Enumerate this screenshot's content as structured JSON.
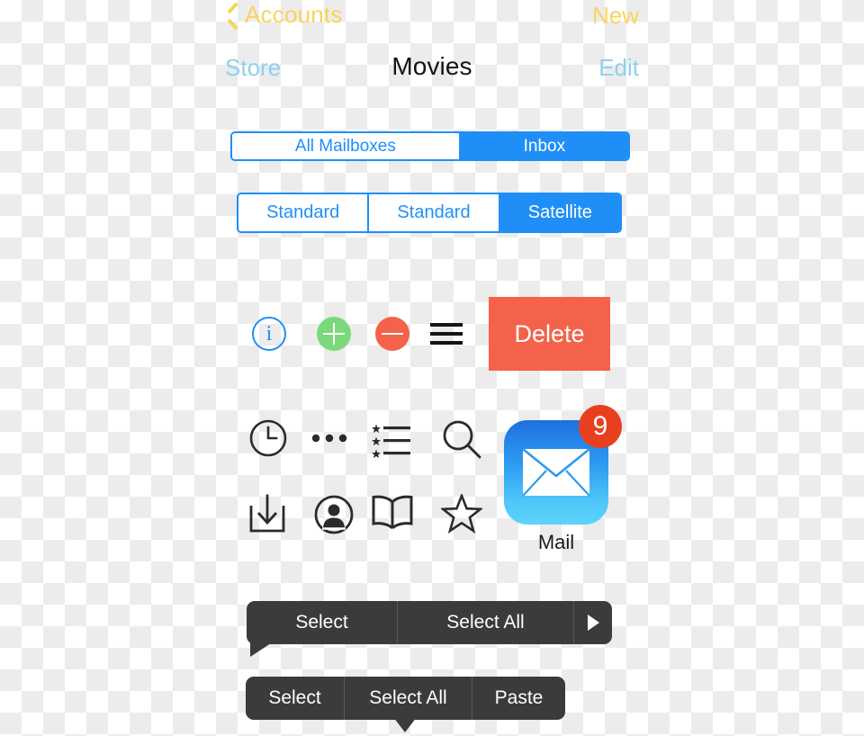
{
  "nav": {
    "row1": {
      "back_label": "Accounts",
      "back_icon": "chevron-left-icon",
      "right_label": "New"
    },
    "row2": {
      "left_label": "Store",
      "title": "Movies",
      "right_label": "Edit"
    }
  },
  "segmented_controls": [
    {
      "name": "mailbox-scope",
      "options": [
        {
          "label": "All Mailboxes",
          "selected": false
        },
        {
          "label": "Inbox",
          "selected": true
        }
      ]
    },
    {
      "name": "map-type",
      "options": [
        {
          "label": "Standard",
          "selected": false
        },
        {
          "label": "Standard",
          "selected": false
        },
        {
          "label": "Satellite",
          "selected": true
        }
      ]
    }
  ],
  "controls_row": {
    "info_glyph": "i",
    "info_icon": "info-circle-icon",
    "add_icon": "plus-circle-icon",
    "remove_icon": "minus-circle-icon",
    "reorder_icon": "hamburger-icon",
    "delete_label": "Delete"
  },
  "glyph_icons": [
    {
      "name": "clock-icon",
      "label": "clock"
    },
    {
      "name": "ellipsis-icon",
      "label": "more"
    },
    {
      "name": "starred-list-icon",
      "label": "starred list"
    },
    {
      "name": "search-icon",
      "label": "search"
    },
    {
      "name": "download-icon",
      "label": "download"
    },
    {
      "name": "contact-icon",
      "label": "contact"
    },
    {
      "name": "book-icon",
      "label": "book"
    },
    {
      "name": "star-icon",
      "label": "star"
    }
  ],
  "app_icon": {
    "name": "mail-app-icon",
    "label": "Mail",
    "badge_count": "9",
    "glyph": "envelope-icon"
  },
  "context_menus": [
    {
      "name": "edit-menu-primary",
      "items": [
        {
          "label": "Select",
          "type": "text"
        },
        {
          "label": "Select All",
          "type": "text"
        },
        {
          "label": "▶",
          "type": "arrow",
          "icon": "play-arrow-icon"
        }
      ]
    },
    {
      "name": "edit-menu-paste",
      "items": [
        {
          "label": "Select",
          "type": "text"
        },
        {
          "label": "Select All",
          "type": "text"
        },
        {
          "label": "Paste",
          "type": "text"
        }
      ]
    }
  ],
  "colors": {
    "accent_blue": "#1F8FF7",
    "light_blue": "#8FD0F0",
    "gold": "#F9D45C",
    "danger_red": "#F4624A",
    "badge_red": "#E8401F",
    "success_green": "#7BD97B",
    "menu_dark": "#3B3B3B"
  }
}
